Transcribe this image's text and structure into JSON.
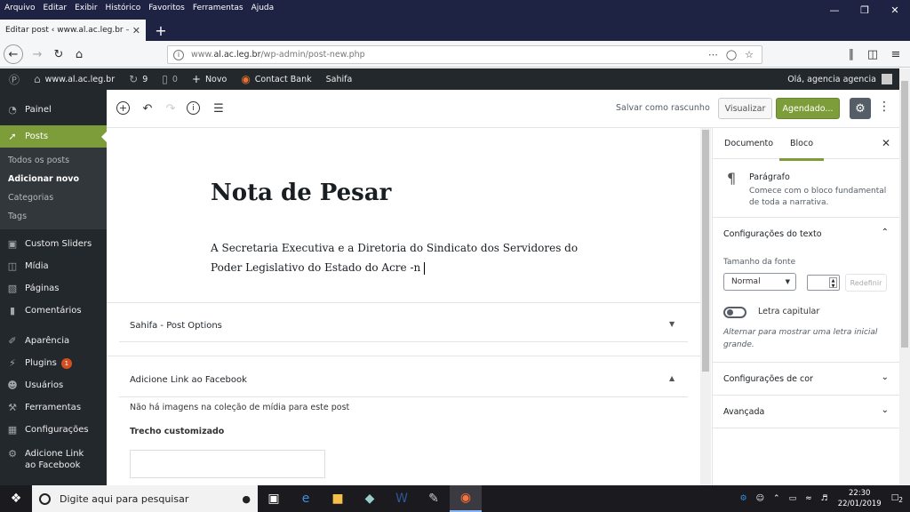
{
  "browser": {
    "menu": [
      "Arquivo",
      "Editar",
      "Exibir",
      "Histórico",
      "Favoritos",
      "Ferramentas",
      "Ajuda"
    ],
    "tab_title": "Editar post ‹ www.al.ac.leg.br — W",
    "url_prefix": "www.",
    "url_domain": "al.ac.leg.br",
    "url_path": "/wp-admin/post-new.php"
  },
  "adminbar": {
    "site": "www.al.ac.leg.br",
    "updates": "9",
    "comments": "0",
    "new": "Novo",
    "contact": "Contact Bank",
    "sahifa": "Sahifa",
    "greeting": "Olá, agencia agencia"
  },
  "sidebar": {
    "painel": "Painel",
    "posts": "Posts",
    "sub": [
      "Todos os posts",
      "Adicionar novo",
      "Categorias",
      "Tags"
    ],
    "custom_sliders": "Custom Sliders",
    "midia": "Mídia",
    "paginas": "Páginas",
    "comentarios": "Comentários",
    "aparencia": "Aparência",
    "plugins": "Plugins",
    "plugins_badge": "1",
    "usuarios": "Usuários",
    "ferramentas": "Ferramentas",
    "configuracoes": "Configurações",
    "fb_link": "Adicione Link ao Facebook"
  },
  "toolbar": {
    "save_draft": "Salvar como rascunho",
    "preview": "Visualizar",
    "schedule": "Agendado..."
  },
  "post": {
    "title": "Nota de Pesar",
    "paragraph": "A Secretaria Executiva e a Diretoria do Sindicato dos Servidores do Poder Legislativo do Estado do Acre -n"
  },
  "metaboxes": {
    "sahifa": "Sahifa - Post Options",
    "facebook": "Adicione Link ao Facebook",
    "no_images": "Não há imagens na coleção de mídia para este post",
    "excerpt_label": "Trecho customizado"
  },
  "panel": {
    "tab_document": "Documento",
    "tab_block": "Bloco",
    "block_name": "Parágrafo",
    "block_desc": "Comece com o bloco fundamental de toda a narrativa.",
    "text_settings": "Configurações do texto",
    "font_size_label": "Tamanho da fonte",
    "font_size_value": "Normal",
    "reset": "Redefinir",
    "drop_cap": "Letra capitular",
    "drop_cap_help": "Alternar para mostrar uma letra inicial grande.",
    "color_settings": "Configurações de cor",
    "advanced": "Avançada"
  },
  "taskbar": {
    "search_placeholder": "Digite aqui para pesquisar",
    "time": "22:30",
    "date": "22/01/2019",
    "notif": "2"
  },
  "colors": {
    "wp_dark": "#23282d",
    "accent_green": "#7d9d3a",
    "firefox_frame": "#1e2243"
  }
}
